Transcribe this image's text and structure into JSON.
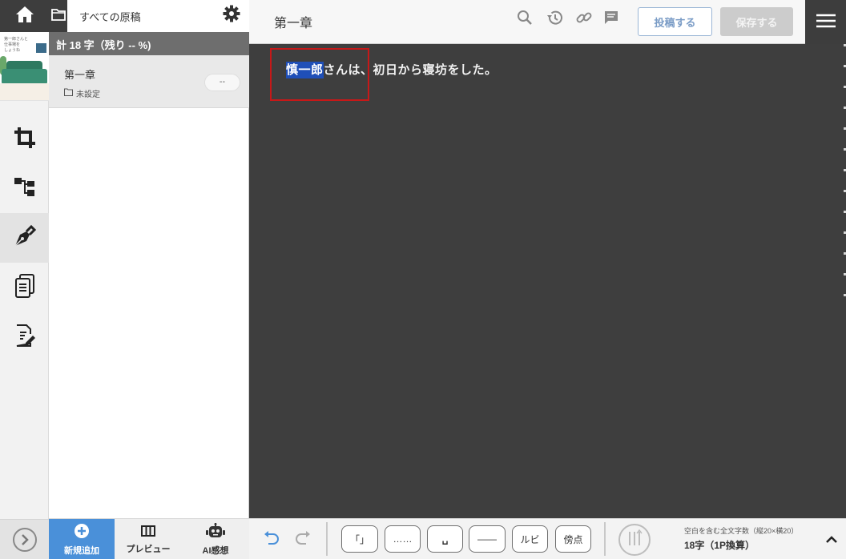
{
  "sidebar": {
    "header_title": "すべての原稿",
    "total_count": "計 18 字（残り -- %)",
    "items": [
      {
        "title": "第一章",
        "folder": "未設定",
        "badge": "--"
      }
    ],
    "bottom": {
      "add_label": "新規追加",
      "preview_label": "プレビュー",
      "ai_label": "AI感想"
    }
  },
  "rail": {
    "thumbnail_text": [
      "第一郎さんと",
      "仕事場を",
      "しょうね"
    ],
    "icons": [
      "home-icon",
      "crop-icon",
      "structure-icon",
      "pen-icon",
      "documents-icon",
      "edit-document-icon"
    ]
  },
  "editor": {
    "chapter_title": "第一章",
    "post_label": "投稿する",
    "save_label": "保存する",
    "selected_text": "慎一郎",
    "body_text": "さんは、初日から寝坊をした。"
  },
  "toolbar": {
    "kagikakko": "「」",
    "ellipsis": "……",
    "space": "␣",
    "dash": "——",
    "ruby": "ルビ",
    "bouten": "傍点",
    "count_label": "空白を含む全文字数（縦20×横20）",
    "count_value": "18字（1P換算）"
  },
  "colors": {
    "accent": "#4a90d9",
    "editor_bg": "#3e3e3e",
    "selection": "#1f4fb8",
    "highlight_box": "#c71818"
  }
}
